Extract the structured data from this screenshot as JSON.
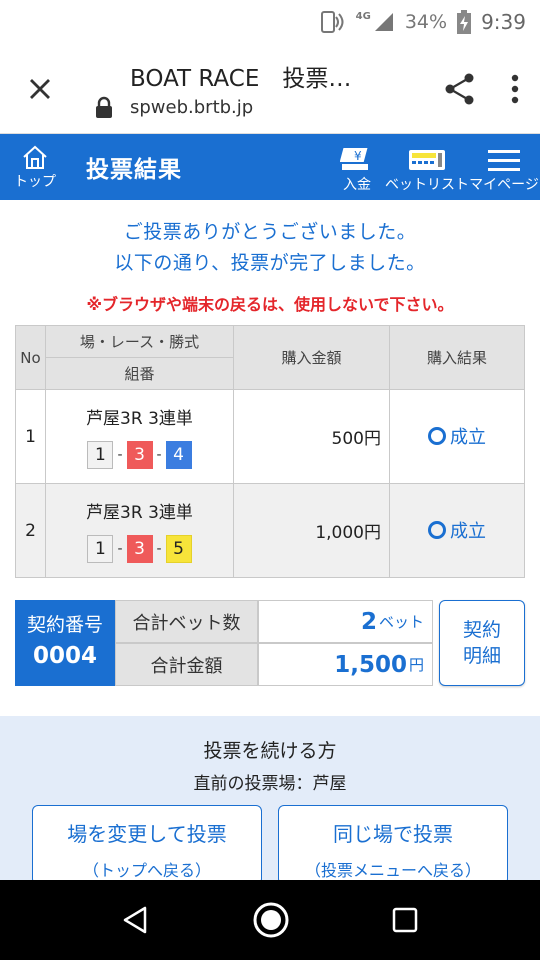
{
  "status": {
    "lte": "4G",
    "battery": "34%",
    "time": "9:39"
  },
  "browser": {
    "title": "BOAT RACE　投票…",
    "url": "spweb.brtb.jp"
  },
  "header": {
    "home_label": "トップ",
    "title": "投票結果",
    "deposit_label": "入金",
    "betlist_label": "ベットリスト",
    "mypage_label": "マイページ"
  },
  "message": {
    "line1": "ご投票ありがとうございました。",
    "line2": "以下の通り、投票が完了しました。",
    "warning": "※ブラウザや端末の戻るは、使用しないで下さい。"
  },
  "table": {
    "col_no": "No",
    "col_bet": "場・レース・勝式",
    "col_combo": "組番",
    "col_amount": "購入金額",
    "col_result": "購入結果",
    "rows": [
      {
        "no": "1",
        "bet": "芦屋3R 3連単",
        "combo": [
          "1",
          "3",
          "4"
        ],
        "amount": "500円",
        "result": "成立"
      },
      {
        "no": "2",
        "bet": "芦屋3R 3連単",
        "combo": [
          "1",
          "3",
          "5"
        ],
        "amount": "1,000円",
        "result": "成立"
      }
    ],
    "dash": "-"
  },
  "summary": {
    "contract_label": "契約番号",
    "contract_no": "0004",
    "bet_count_label": "合計ベット数",
    "bet_count": "2",
    "bet_unit": "ベット",
    "total_label": "合計金額",
    "total": "1,500",
    "total_unit": "円",
    "detail_line1": "契約",
    "detail_line2": "明細"
  },
  "continue": {
    "title": "投票を続ける方",
    "sub": "直前の投票場：芦屋",
    "btn1_main": "場を変更して投票",
    "btn1_sub": "（トップへ戻る）",
    "btn2_main": "同じ場で投票",
    "btn2_sub": "（投票メニューへ戻る）"
  },
  "colors": {
    "brand": "#1a6fd1",
    "warning": "#e4262b",
    "boat3": "#ef5a5a",
    "boat4": "#3b7de0",
    "boat5": "#f7e43a"
  }
}
